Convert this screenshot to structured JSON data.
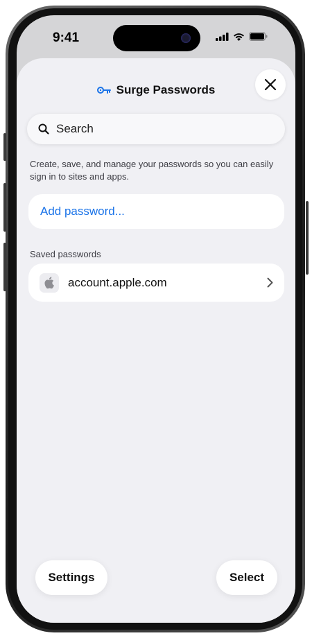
{
  "status_bar": {
    "time": "9:41"
  },
  "sheet": {
    "title": "Surge Passwords",
    "title_icon": "key-icon",
    "close_icon": "close-icon"
  },
  "search": {
    "placeholder": "Search",
    "value": ""
  },
  "description": "Create, save, and manage your passwords so you can easily sign in to sites and apps.",
  "add_password": {
    "label": "Add password..."
  },
  "saved_passwords": {
    "section_label": "Saved passwords",
    "items": [
      {
        "site": "account.apple.com",
        "icon": "apple-logo-icon"
      }
    ]
  },
  "bottom_bar": {
    "settings_label": "Settings",
    "select_label": "Select"
  },
  "colors": {
    "accent": "#1a73e8",
    "sheet_background": "#f0f0f4",
    "card_background": "#ffffff"
  }
}
